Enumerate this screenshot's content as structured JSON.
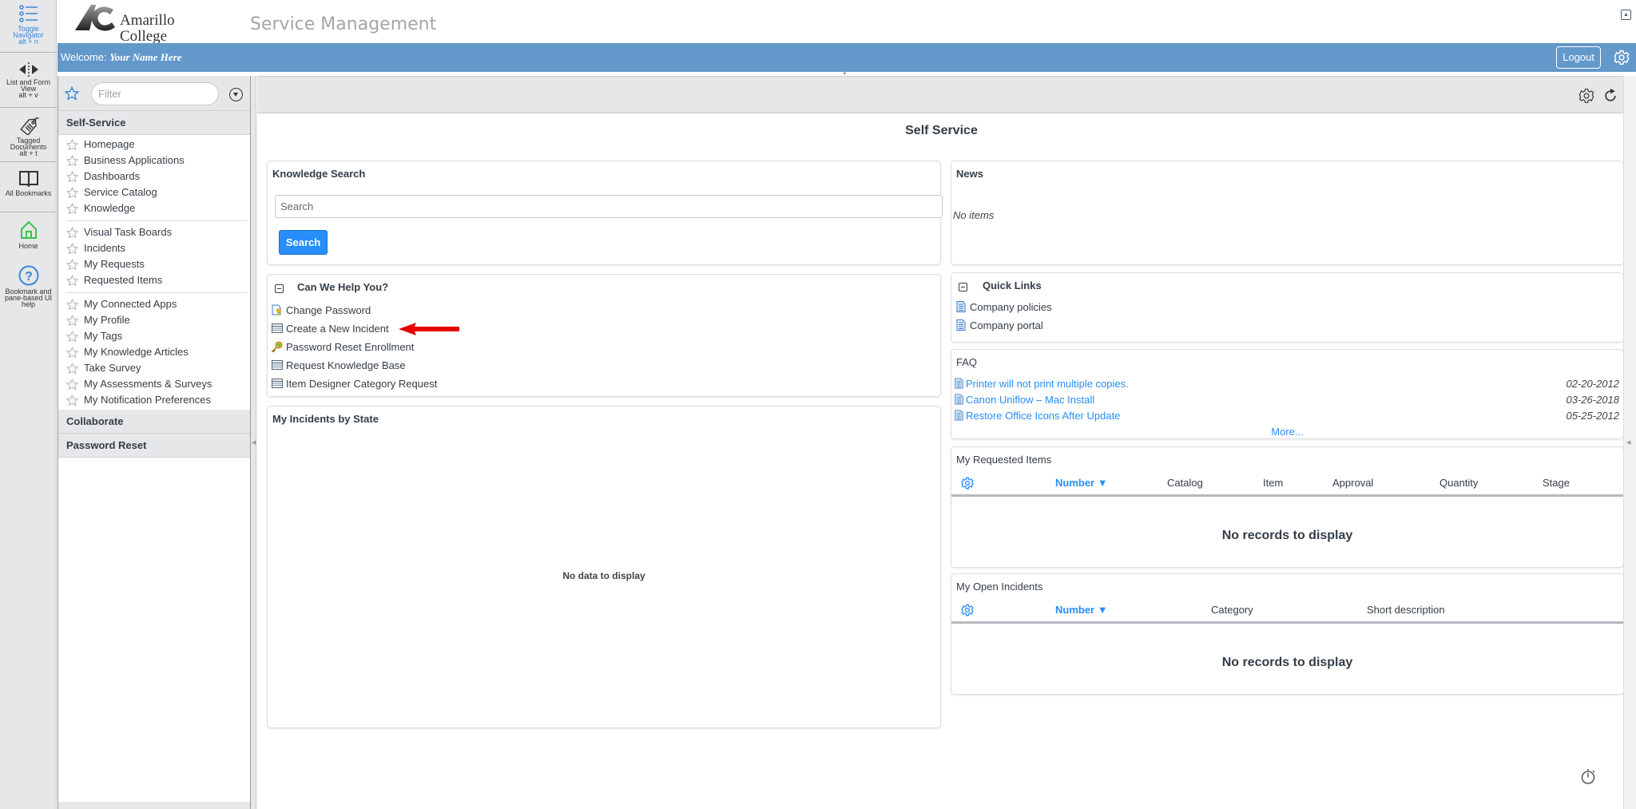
{
  "rail": {
    "items": [
      {
        "icon": "list-icon",
        "label": "Toggle Navigator",
        "shortcut": "alt + n"
      },
      {
        "icon": "split-view-icon",
        "label": "List and Form View",
        "shortcut": "alt + v"
      },
      {
        "icon": "tag-icon",
        "label": "Tagged Documents",
        "shortcut": "alt + t"
      },
      {
        "icon": "book-icon",
        "label": "All Bookmarks",
        "shortcut": ""
      },
      {
        "icon": "home-icon",
        "label": "Home",
        "shortcut": ""
      },
      {
        "icon": "help-icon",
        "label": "Bookmark and pane-based UI help",
        "shortcut": ""
      }
    ]
  },
  "header": {
    "logo_text": "Amarillo College",
    "app_title": "Service Management",
    "welcome_label": "Welcome:",
    "user_name": "Your Name Here",
    "logout_label": "Logout"
  },
  "navigator": {
    "filter_placeholder": "Filter",
    "sections": [
      {
        "title": "Self-Service",
        "groups": [
          [
            "Homepage",
            "Business Applications",
            "Dashboards",
            "Service Catalog",
            "Knowledge"
          ],
          [
            "Visual Task Boards",
            "Incidents",
            "My Requests",
            "Requested Items"
          ],
          [
            "My Connected Apps",
            "My Profile",
            "My Tags",
            "My Knowledge Articles",
            "Take Survey",
            "My Assessments & Surveys",
            "My Notification Preferences"
          ]
        ]
      },
      {
        "title": "Collaborate"
      },
      {
        "title": "Password Reset"
      }
    ]
  },
  "main": {
    "page_title": "Self Service",
    "knowledge_search": {
      "title": "Knowledge Search",
      "placeholder": "Search",
      "button_label": "Search"
    },
    "help": {
      "title": "Can We Help You?",
      "links": [
        {
          "icon": "key-document-icon",
          "label": "Change Password"
        },
        {
          "icon": "form-icon",
          "label": "Create a New Incident"
        },
        {
          "icon": "key-check-icon",
          "label": "Password Reset Enrollment"
        },
        {
          "icon": "form-icon",
          "label": "Request Knowledge Base"
        },
        {
          "icon": "form-icon",
          "label": "Item Designer Category Request"
        }
      ]
    },
    "incidents_by_state": {
      "title": "My Incidents by State",
      "empty": "No data to display"
    },
    "news": {
      "title": "News",
      "empty": "No items"
    },
    "quick_links": {
      "title": "Quick Links",
      "links": [
        "Company policies",
        "Company portal"
      ]
    },
    "faq": {
      "title": "FAQ",
      "items": [
        {
          "label": "Printer will not print multiple copies.",
          "date": "02-20-2012"
        },
        {
          "label": "Canon Uniflow – Mac Install",
          "date": "03-26-2018"
        },
        {
          "label": "Restore Office Icons After Update",
          "date": "05-25-2012"
        }
      ],
      "more_label": "More..."
    },
    "requested_items": {
      "title": "My Requested Items",
      "columns": [
        "Number ▼",
        "Catalog",
        "Item",
        "Approval",
        "Quantity",
        "Stage"
      ],
      "empty": "No records to display"
    },
    "open_incidents": {
      "title": "My Open Incidents",
      "columns": [
        "Number ▼",
        "Category",
        "Short description"
      ],
      "empty": "No records to display"
    }
  },
  "colors": {
    "welcome_bar": "#6398cb",
    "accent": "#278efc",
    "annotation_arrow": "#e60000"
  }
}
